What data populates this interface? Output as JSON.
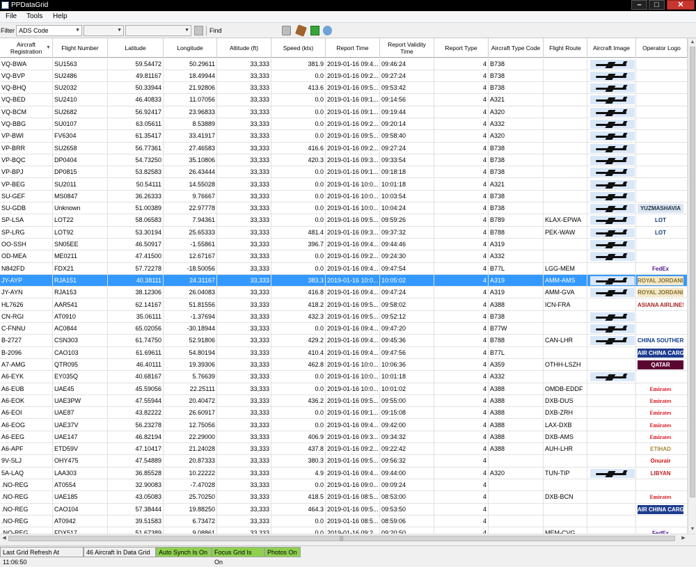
{
  "window": {
    "title": "PPDataGrid",
    "min": "–",
    "max": "□",
    "close": "✕"
  },
  "menu": [
    "File",
    "Tools",
    "Help"
  ],
  "toolbar": {
    "filter_label": "Filter",
    "filter_value": "ADS Code",
    "find_label": "Find"
  },
  "columns": [
    "Aircraft Registration",
    "Flight Number",
    "Latitude",
    "Longitude",
    "Altitude (ft)",
    "Speed (kts)",
    "Report Time",
    "Report Validity Time",
    "Report Type",
    "Aircraft Type Code",
    "Flight Route",
    "Aircraft Image",
    "Operator Logo"
  ],
  "rows": [
    [
      "VQ-BWA",
      "SU1563",
      "59.54472",
      "50.29611",
      "33,333",
      "381.9",
      "2019-01-16 09:4...",
      "09:46:24",
      "4",
      "B738",
      "",
      "plane",
      ""
    ],
    [
      "VQ-BVP",
      "SU2486",
      "49.81167",
      "18.49944",
      "33,333",
      "0.0",
      "2019-01-16 09:2...",
      "09:27:24",
      "4",
      "B738",
      "",
      "plane",
      ""
    ],
    [
      "VQ-BHQ",
      "SU2032",
      "50.33944",
      "21.92806",
      "33,333",
      "413.6",
      "2019-01-16 09:5...",
      "09:53:42",
      "4",
      "B738",
      "",
      "plane",
      ""
    ],
    [
      "VQ-BED",
      "SU2410",
      "46.40833",
      "11.07056",
      "33,333",
      "0.0",
      "2019-01-16 09:1...",
      "09:14:56",
      "4",
      "A321",
      "",
      "plane",
      ""
    ],
    [
      "VQ-BCM",
      "SU2682",
      "56.92417",
      "23.96833",
      "33,333",
      "0.0",
      "2019-01-16 09:1...",
      "09:19:44",
      "4",
      "A320",
      "",
      "plane",
      ""
    ],
    [
      "VQ-BBG",
      "SU0107",
      "63.05611",
      "8.53889",
      "33,333",
      "0.0",
      "2019-01-16 09:2...",
      "09:20:14",
      "4",
      "A332",
      "",
      "plane",
      ""
    ],
    [
      "VP-BWI",
      "FV6304",
      "61.35417",
      "33.41917",
      "33,333",
      "0.0",
      "2019-01-16 09:5...",
      "09:58:40",
      "4",
      "A320",
      "",
      "plane",
      ""
    ],
    [
      "VP-BRR",
      "SU2658",
      "56.77361",
      "27.46583",
      "33,333",
      "416.6",
      "2019-01-16 09:2...",
      "09:27:24",
      "4",
      "B738",
      "",
      "plane",
      ""
    ],
    [
      "VP-BQC",
      "DP0404",
      "54.73250",
      "35.10806",
      "33,333",
      "420.3",
      "2019-01-16 09:3...",
      "09:33:54",
      "4",
      "B738",
      "",
      "plane",
      ""
    ],
    [
      "VP-BPJ",
      "DP0815",
      "53.82583",
      "26.43444",
      "33,333",
      "0.0",
      "2019-01-16 09:1...",
      "09:18:18",
      "4",
      "B738",
      "",
      "plane",
      ""
    ],
    [
      "VP-BEG",
      "SU2011",
      "50.54111",
      "14.55028",
      "33,333",
      "0.0",
      "2019-01-16 10:0...",
      "10:01:18",
      "4",
      "A321",
      "",
      "plane",
      ""
    ],
    [
      "SU-GEF",
      "MS0847",
      "36.26333",
      "9.76667",
      "33,333",
      "0.0",
      "2019-01-16 10:0...",
      "10:03:54",
      "4",
      "B738",
      "",
      "plane",
      ""
    ],
    [
      "SU-GDB",
      "Unknown",
      "51.00389",
      "22.97778",
      "33,333",
      "0.0",
      "2019-01-16 10:0...",
      "10:04:24",
      "4",
      "B738",
      "",
      "plane",
      "YUZMASHAVIA"
    ],
    [
      "SP-LSA",
      "LOT22",
      "58.06583",
      "7.94361",
      "33,333",
      "0.0",
      "2019-01-16 09:5...",
      "09:59:26",
      "4",
      "B789",
      "KLAX-EPWA",
      "plane",
      "LOT"
    ],
    [
      "SP-LRG",
      "LOT92",
      "53.30194",
      "25.65333",
      "33,333",
      "481.4",
      "2019-01-16 09:3...",
      "09:37:32",
      "4",
      "B788",
      "PEK-WAW",
      "plane",
      "LOT"
    ],
    [
      "OO-SSH",
      "SN05EE",
      "46.50917",
      "-1.55861",
      "33,333",
      "396.7",
      "2019-01-16 09:4...",
      "09:44:46",
      "4",
      "A319",
      "",
      "plane",
      ""
    ],
    [
      "OD-MEA",
      "ME0211",
      "47.41500",
      "12.67167",
      "33,333",
      "0.0",
      "2019-01-16 09:2...",
      "09:24:30",
      "4",
      "A332",
      "",
      "plane",
      ""
    ],
    [
      "N842FD",
      "FDX21",
      "57.72278",
      "-18.50056",
      "33,333",
      "0.0",
      "2019-01-16 09:4...",
      "09:47:54",
      "4",
      "B77L",
      "LGG-MEM",
      "",
      "FedEx"
    ],
    [
      "JY-AYP",
      "RJA151",
      "40.38111",
      "24.31167",
      "33,333",
      "383.3",
      "2019-01-16 10:0...",
      "10:05:02",
      "4",
      "A319",
      "AMM-AMS",
      "plane",
      "ROYAL JORDANIAN"
    ],
    [
      "JY-AYN",
      "RJA153",
      "38.12306",
      "26.04083",
      "33,333",
      "416.8",
      "2019-01-16 09:4...",
      "09:47:24",
      "4",
      "A319",
      "AMM-GVA",
      "plane",
      "ROYAL JORDANIAN"
    ],
    [
      "HL7626",
      "AAR541",
      "62.14167",
      "51.81556",
      "33,333",
      "418.2",
      "2019-01-16 09:5...",
      "09:58:02",
      "4",
      "A388",
      "ICN-FRA",
      "",
      "ASIANA AIRLINES"
    ],
    [
      "CN-RGI",
      "AT0910",
      "35.06111",
      "-1.37694",
      "33,333",
      "432.3",
      "2019-01-16 09:5...",
      "09:52:12",
      "4",
      "B738",
      "",
      "plane",
      ""
    ],
    [
      "C-FNNU",
      "AC0844",
      "65.02056",
      "-30.18944",
      "33,333",
      "0.0",
      "2019-01-16 09:4...",
      "09:47:20",
      "4",
      "B77W",
      "",
      "plane",
      ""
    ],
    [
      "B-2727",
      "CSN303",
      "61.74750",
      "52.91806",
      "33,333",
      "429.2",
      "2019-01-16 09:4...",
      "09:45:36",
      "4",
      "B788",
      "CAN-LHR",
      "plane",
      "CHINA SOUTHERN"
    ],
    [
      "B-2096",
      "CAO103",
      "61.69611",
      "54.80194",
      "33,333",
      "410.4",
      "2019-01-16 09:4...",
      "09:47:56",
      "4",
      "B77L",
      "",
      "",
      "AIR CHINA CARGO"
    ],
    [
      "A7-AMG",
      "QTR095",
      "46.40111",
      "19.39306",
      "33,333",
      "462.8",
      "2019-01-16 10:0...",
      "10:06:36",
      "4",
      "A359",
      "OTHH-LSZH",
      "",
      "QATAR"
    ],
    [
      "A6-EYK",
      "EY035Q",
      "40.68167",
      "5.76639",
      "33,333",
      "0.0",
      "2019-01-16 10:0...",
      "10:01:18",
      "4",
      "A332",
      "",
      "plane",
      ""
    ],
    [
      "A6-EUB",
      "UAE45",
      "45.59056",
      "22.25111",
      "33,333",
      "0.0",
      "2019-01-16 10:0...",
      "10:01:02",
      "4",
      "A388",
      "OMDB-EDDF",
      "",
      "Emirates"
    ],
    [
      "A6-EOK",
      "UAE3PW",
      "47.55944",
      "20.40472",
      "33,333",
      "436.2",
      "2019-01-16 09:5...",
      "09:55:00",
      "4",
      "A388",
      "DXB-DUS",
      "",
      "Emirates"
    ],
    [
      "A6-EOI",
      "UAE87",
      "43.82222",
      "26.60917",
      "33,333",
      "0.0",
      "2019-01-16 09:1...",
      "09:15:08",
      "4",
      "A388",
      "DXB-ZRH",
      "",
      "Emirates"
    ],
    [
      "A6-EOG",
      "UAE37V",
      "56.23278",
      "12.75056",
      "33,333",
      "0.0",
      "2019-01-16 09:4...",
      "09:42:00",
      "4",
      "A388",
      "LAX-DXB",
      "",
      "Emirates"
    ],
    [
      "A6-EEG",
      "UAE147",
      "46.82194",
      "22.29000",
      "33,333",
      "406.9",
      "2019-01-16 09:3...",
      "09:34:32",
      "4",
      "A388",
      "DXB-AMS",
      "",
      "Emirates"
    ],
    [
      "A6-APF",
      "ETD59V",
      "47.10417",
      "21.24028",
      "33,333",
      "437.8",
      "2019-01-16 09:2...",
      "09:22:42",
      "4",
      "A388",
      "AUH-LHR",
      "",
      "ETIHAD"
    ],
    [
      "9V-SLJ",
      "OHY475",
      "47.54889",
      "20.87333",
      "33,333",
      "380.3",
      "2019-01-16 09:5...",
      "09:56:32",
      "4",
      "",
      "",
      "",
      "Onurair"
    ],
    [
      "5A-LAQ",
      "LAA303",
      "36.85528",
      "10.22222",
      "33,333",
      "4.9",
      "2019-01-16 09:4...",
      "09:44:00",
      "4",
      "A320",
      "TUN-TIP",
      "plane",
      "LIBYAN"
    ],
    [
      ".NO-REG",
      "AT0554",
      "32.90083",
      "-7.47028",
      "33,333",
      "0.0",
      "2019-01-16 09:0...",
      "09:09:24",
      "4",
      "",
      "",
      "",
      ""
    ],
    [
      ".NO-REG",
      "UAE185",
      "43.05083",
      "25.70250",
      "33,333",
      "418.5",
      "2019-01-16 08:5...",
      "08:53:00",
      "4",
      "",
      "DXB-BCN",
      "",
      "Emirates"
    ],
    [
      ".NO-REG",
      "CAO104",
      "57.38444",
      "19.88250",
      "33,333",
      "464.3",
      "2019-01-16 09:5...",
      "09:53:50",
      "4",
      "",
      "",
      "",
      "AIR CHINA CARGO"
    ],
    [
      ".NO-REG",
      "AT0942",
      "39.51583",
      "6.73472",
      "33,333",
      "0.0",
      "2019-01-16 08:5...",
      "08:59:06",
      "4",
      "",
      "",
      "",
      ""
    ],
    [
      ".NO-REG",
      "FDX517",
      "51.67389",
      "9.08861",
      "33,333",
      "0.0",
      "2019-01-16 09:2...",
      "09:20:50",
      "4",
      "",
      "MEM-CVG",
      "",
      "FedEx"
    ]
  ],
  "selected_row": 18,
  "status": [
    "Last Grid Refresh At 11:06:50",
    "46 Aircraft In Data Grid",
    "Auto Synch Is On",
    "Focus Grid Is On",
    "Photos On"
  ],
  "colors": {
    "selection": "#3399ff",
    "status_green": "#8fd14f"
  }
}
